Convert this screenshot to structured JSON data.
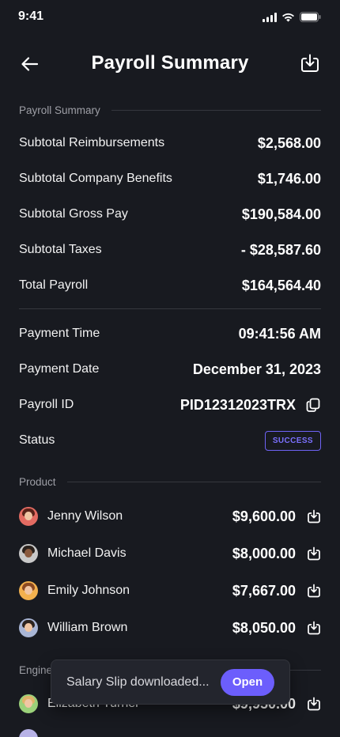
{
  "status_bar": {
    "time": "9:41"
  },
  "header": {
    "title": "Payroll Summary"
  },
  "summary": {
    "section_label": "Payroll Summary",
    "rows": [
      {
        "label": "Subtotal Reimbursements",
        "value": "$2,568.00"
      },
      {
        "label": "Subtotal Company Benefits",
        "value": "$1,746.00"
      },
      {
        "label": "Subtotal Gross Pay",
        "value": "$190,584.00"
      },
      {
        "label": "Subtotal Taxes",
        "value": "- $28,587.60"
      },
      {
        "label": "Total Payroll",
        "value": "$164,564.40"
      }
    ]
  },
  "payment": {
    "time_label": "Payment Time",
    "time_value": "09:41:56 AM",
    "date_label": "Payment Date",
    "date_value": "December 31, 2023",
    "id_label": "Payroll ID",
    "id_value": "PID12312023TRX",
    "status_label": "Status",
    "status_value": "SUCCESS"
  },
  "product": {
    "section_label": "Product",
    "people": [
      {
        "name": "Jenny Wilson",
        "amount": "$9,600.00"
      },
      {
        "name": "Michael Davis",
        "amount": "$8,000.00"
      },
      {
        "name": "Emily Johnson",
        "amount": "$7,667.00"
      },
      {
        "name": "William Brown",
        "amount": "$8,050.00"
      }
    ]
  },
  "engineering": {
    "section_label": "Engine",
    "people": [
      {
        "name": "Elizabeth Turner",
        "amount": "$9,950.00"
      }
    ]
  },
  "toast": {
    "message": "Salary Slip downloaded...",
    "action": "Open"
  },
  "colors": {
    "background": "#181a20",
    "accent": "#6c5efc",
    "badge": "#7b70ff"
  }
}
